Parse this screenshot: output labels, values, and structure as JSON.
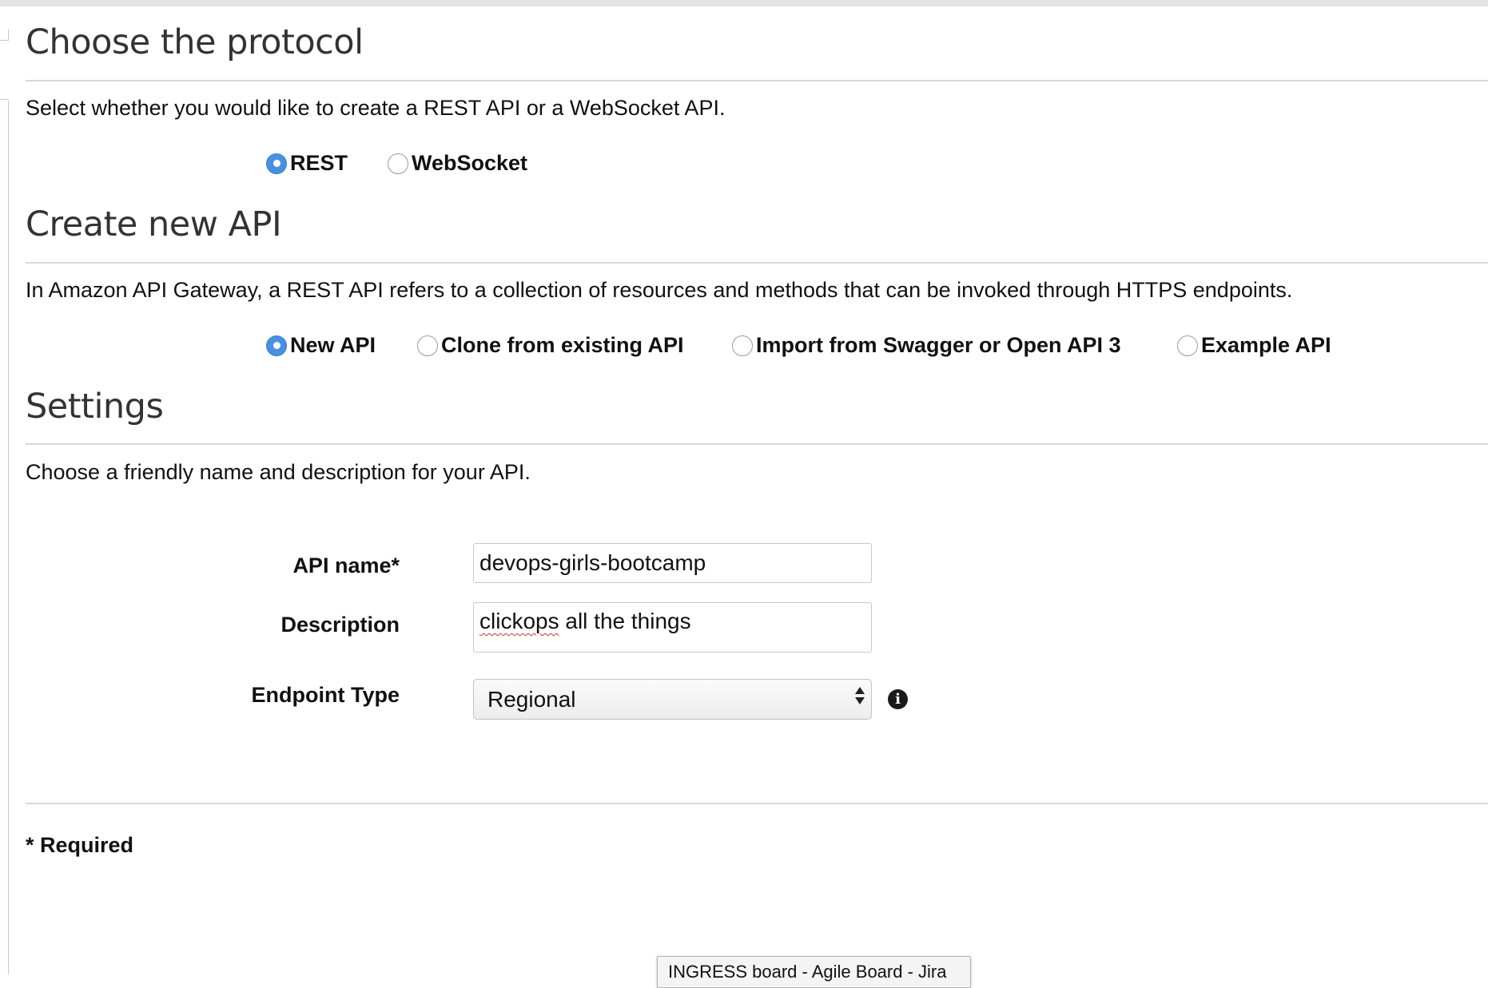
{
  "protocol": {
    "heading": "Choose the protocol",
    "description": "Select whether you would like to create a REST API or a WebSocket API.",
    "options": [
      {
        "label": "REST",
        "checked": true
      },
      {
        "label": "WebSocket",
        "checked": false
      }
    ]
  },
  "create_api": {
    "heading": "Create new API",
    "description": "In Amazon API Gateway, a REST API refers to a collection of resources and methods that can be invoked through HTTPS endpoints.",
    "options": [
      {
        "label": "New API",
        "checked": true
      },
      {
        "label": "Clone from existing API",
        "checked": false
      },
      {
        "label": "Import from Swagger or Open API 3",
        "checked": false
      },
      {
        "label": "Example API",
        "checked": false
      }
    ]
  },
  "settings": {
    "heading": "Settings",
    "description": "Choose a friendly name and description for your API.",
    "api_name_label": "API name*",
    "api_name_value": "devops-girls-bootcamp",
    "description_label": "Description",
    "description_value_misspelled": "clickops",
    "description_value_rest": " all the things",
    "endpoint_type_label": "Endpoint Type",
    "endpoint_type_value": "Regional"
  },
  "footer": {
    "required_note": "* Required"
  },
  "tooltip": {
    "text": "INGRESS board - Agile Board - Jira"
  },
  "colors": {
    "radio_checked": "#4a90e2",
    "heading_text": "#333333",
    "rule": "#d7d7d7"
  },
  "icons": {
    "info": "info-circle-icon"
  }
}
